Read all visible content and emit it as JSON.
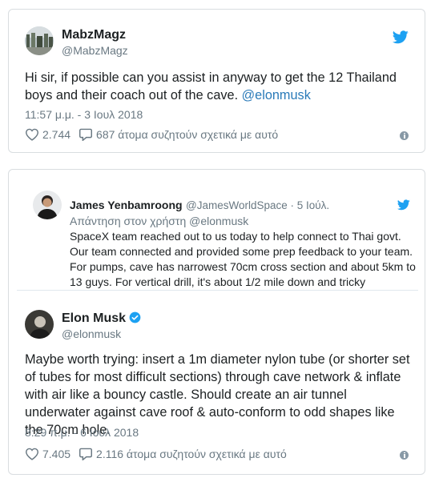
{
  "tweet1": {
    "name": "MabzMagz",
    "handle": "@MabzMagz",
    "text_prefix": "Hi sir, if possible can you assist in anyway to get the 12 Thailand boys and their coach out of the cave. ",
    "mention": "@elonmusk",
    "time": "11:57 μ.μ. - 3 Ιουλ 2018",
    "likes": "2.744",
    "replies": "687 άτομα συζητούν σχετικά με αυτό"
  },
  "quoted": {
    "name": "James Yenbamroong",
    "handle": "@JamesWorldSpace · 5 Ιούλ.",
    "reply_to": "Απάντηση στον χρήστη @elonmusk",
    "text": "SpaceX team reached out to us today to help connect to Thai govt. Our team connected and provided some prep feedback to your team. For pumps, cave has narrowest 70cm cross section and about 5km to 13 guys.  For vertical drill, it's about 1/2 mile down and tricky"
  },
  "tweet2": {
    "name": "Elon Musk",
    "handle": "@elonmusk",
    "text": "Maybe worth trying: insert a 1m diameter nylon tube (or shorter set of tubes for most difficult sections) through cave network & inflate with air like a bouncy castle. Should create an air tunnel underwater against cave roof & auto-conform to odd shapes like the 70cm hole.",
    "time": "8:29 π.μ. - 6 Ιουλ 2018",
    "likes": "7.405",
    "replies": "2.116 άτομα συζητούν σχετικά με αυτό"
  },
  "colors": {
    "twitter_blue": "#1da1f2",
    "link": "#2b7bb9",
    "muted": "#697882",
    "border": "#d9dde0"
  },
  "icons": [
    "twitter-bird-icon",
    "heart-icon",
    "reply-bubble-icon",
    "info-icon",
    "verified-badge-icon"
  ]
}
